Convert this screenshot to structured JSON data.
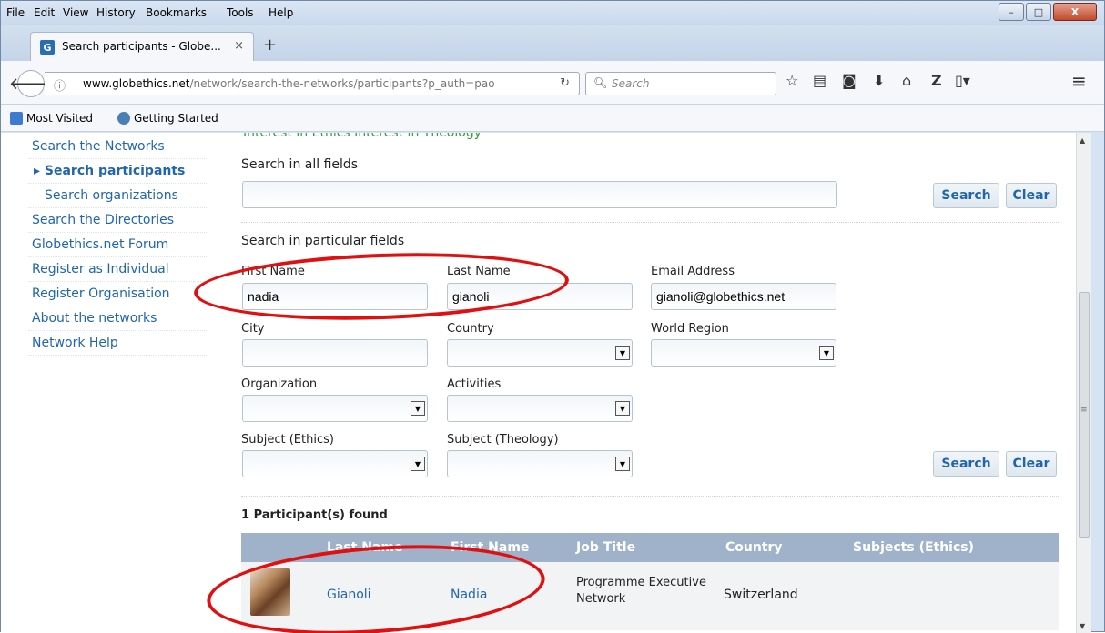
{
  "browser": {
    "menu": [
      "File",
      "Edit",
      "View",
      "History",
      "Bookmarks",
      "Tools",
      "Help"
    ],
    "tab_title": "Search participants - Globe...",
    "tab_close": "×",
    "new_tab": "+",
    "url_domain": "www.globethics.net",
    "url_path": "/network/search-the-networks/participants?p_auth=pao",
    "search_placeholder": "Search",
    "bookmarks": [
      "Most Visited",
      "Getting Started"
    ],
    "window_buttons": {
      "minimize": "–",
      "maximize": "□",
      "close": "X"
    }
  },
  "sidebar": {
    "items": [
      {
        "label": "Search the Networks"
      },
      {
        "label": "▸ Search participants"
      },
      {
        "label": "Search organizations"
      },
      {
        "label": "Search the Directories"
      },
      {
        "label": "Globethics.net Forum"
      },
      {
        "label": "Register as Individual"
      },
      {
        "label": "Register Organisation"
      },
      {
        "label": "About the networks"
      },
      {
        "label": "Network Help"
      }
    ]
  },
  "search": {
    "top_partial": "Interest in Ethics     Interest in Theology",
    "all_fields_title": "Search in all fields",
    "all_fields_value": "",
    "particular_title": "Search in particular fields",
    "search_btn": "Search",
    "clear_btn": "Clear",
    "fields": {
      "first_name_label": "First Name",
      "first_name_value": "nadia",
      "last_name_label": "Last Name",
      "last_name_value": "gianoli",
      "email_label": "Email Address",
      "email_value": "gianoli@globethics.net",
      "city_label": "City",
      "country_label": "Country",
      "world_region_label": "World Region",
      "organization_label": "Organization",
      "activities_label": "Activities",
      "subject_ethics_label": "Subject (Ethics)",
      "subject_theology_label": "Subject (Theology)"
    }
  },
  "results": {
    "count_text": "1 Participant(s) found",
    "columns": [
      "Last Name",
      "First Name",
      "Job Title",
      "Country",
      "Subjects (Ethics)"
    ],
    "rows": [
      {
        "last_name": "Gianoli",
        "first_name": "Nadia",
        "job_title_line1": "Programme Executive",
        "job_title_line2": "Network",
        "country": "Switzerland",
        "subjects": ""
      }
    ]
  },
  "colors": {
    "link": "#2166ad",
    "header_bg": "#9fb2ca",
    "annotation": "#e01010"
  }
}
